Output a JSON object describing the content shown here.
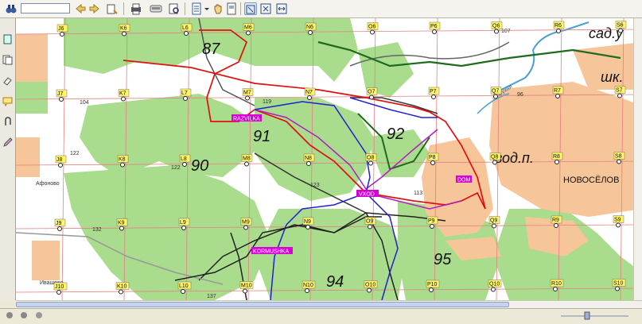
{
  "toolbar": {
    "search_value": "",
    "icons": [
      "binoculars-icon",
      "back-icon",
      "forward-icon",
      "pan-icon",
      "print-icon",
      "page-setup-icon",
      "hand-tool-icon",
      "page-view-icon",
      "zoom-window-icon",
      "fit-page-icon",
      "fit-width-icon"
    ]
  },
  "sidebar": {
    "icons": [
      "page-icon",
      "copy-icon",
      "eraser-icon",
      "comment-icon",
      "attach-icon",
      "edit-icon"
    ]
  },
  "map": {
    "area_labels": [
      "87",
      "91",
      "92",
      "90",
      "95",
      "94"
    ],
    "town_labels": [
      "сад.у",
      "шк.",
      "вод.п.",
      "НОВОСЁЛОВ"
    ],
    "village_labels": [
      "Афоново",
      "Ивашево"
    ],
    "waypoints": [
      "RAZVILKA",
      "VXOD",
      "DOM",
      "KORMUSHKA"
    ],
    "grid_labels": [
      "J6",
      "K6",
      "L6",
      "M6",
      "N6",
      "O6",
      "P6",
      "Q6",
      "R6",
      "S6",
      "J7",
      "K7",
      "L7",
      "M7",
      "N7",
      "O7",
      "P7",
      "Q7",
      "R7",
      "S7",
      "J8",
      "K8",
      "L8",
      "M8",
      "N8",
      "O8",
      "P8",
      "Q8",
      "R8",
      "S8",
      "J9",
      "K9",
      "L9",
      "M9",
      "N9",
      "O9",
      "P9",
      "Q9",
      "R9",
      "S9",
      "J10",
      "K10",
      "L10",
      "M10",
      "N10",
      "O10",
      "P10",
      "Q10",
      "R10",
      "S10"
    ],
    "elevations": [
      "119",
      "122",
      "122",
      "132",
      "123",
      "107",
      "96",
      "104",
      "113",
      "137"
    ],
    "river_label": "Сухая",
    "colors": {
      "forest": "#a9dc8c",
      "open": "#ffffff",
      "grid": "#e06060",
      "town": "#f6c59a",
      "track_red": "#e01010",
      "track_blue": "#2020d0",
      "track_black": "#222222",
      "track_green": "#1e6b1e",
      "track_purple": "#b020c0",
      "waypoint": "#d800d8"
    }
  }
}
